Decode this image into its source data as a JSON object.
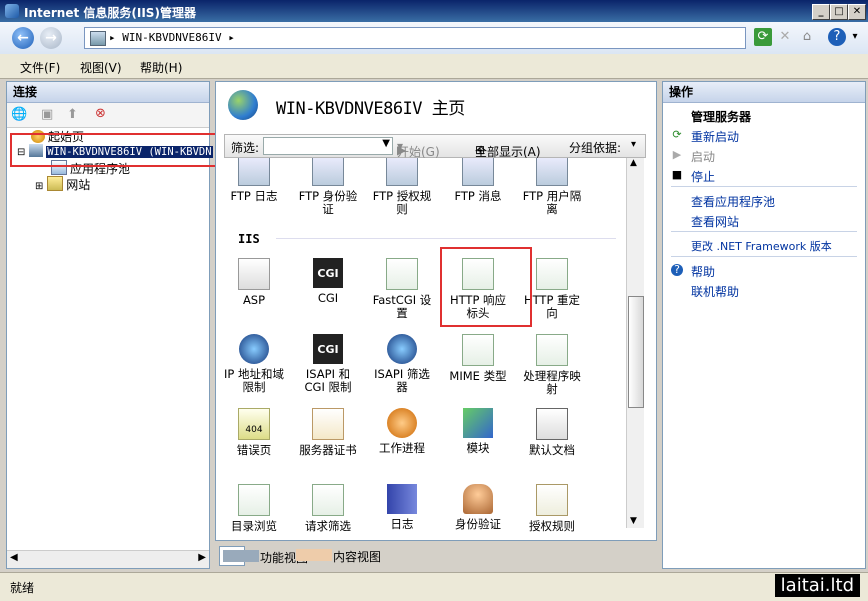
{
  "window": {
    "title": "Internet 信息服务(IIS)管理器"
  },
  "address": {
    "crumb": "WIN-KBVDNVE86IV",
    "arrow": "▸"
  },
  "menu": [
    "文件(F)",
    "视图(V)",
    "帮助(H)"
  ],
  "connections": {
    "header": "连接",
    "tree": [
      {
        "label": "起始页"
      },
      {
        "label": "WIN-KBVDNVE86IV (WIN-KBVDN"
      },
      {
        "label": "应用程序池"
      },
      {
        "label": "网站"
      }
    ]
  },
  "center": {
    "title": "WIN-KBVDNVE86IV 主页",
    "filter_label": "筛选:",
    "start_label": "开始(G)",
    "show_all_label": "全部显示(A)",
    "group_label": "分组依据:",
    "ftp_items": [
      "FTP 日志",
      "FTP 身份验证",
      "FTP 授权规则",
      "FTP 消息",
      "FTP 用户隔离"
    ],
    "section_iis": "IIS",
    "iis_items": [
      "ASP",
      "CGI",
      "FastCGI 设置",
      "HTTP 响应标头",
      "HTTP 重定向",
      "IP 地址和域限制",
      "ISAPI 和 CGI 限制",
      "ISAPI 筛选器",
      "MIME 类型",
      "处理程序映射",
      "错误页",
      "服务器证书",
      "工作进程",
      "模块",
      "默认文档",
      "目录浏览",
      "请求筛选",
      "日志",
      "身份验证",
      "授权规则"
    ],
    "cgi_text": "CGI",
    "ftp_badge": "FTP",
    "error_badge": "404"
  },
  "view_tabs": [
    "功能视图",
    "内容视图"
  ],
  "actions": {
    "header": "操作",
    "manage_server": "管理服务器",
    "restart": "重新启动",
    "start": "启动",
    "stop": "停止",
    "view_app_pools": "查看应用程序池",
    "view_sites": "查看网站",
    "change_framework": "更改 .NET Framework 版本",
    "help": "帮助",
    "online_help": "联机帮助"
  },
  "status": {
    "text": "就绪"
  },
  "watermark": "laitai.ltd",
  "colors": {
    "accent": "#0033a0",
    "highlight_box": "#e03030",
    "titlebar": "#0a246a"
  }
}
